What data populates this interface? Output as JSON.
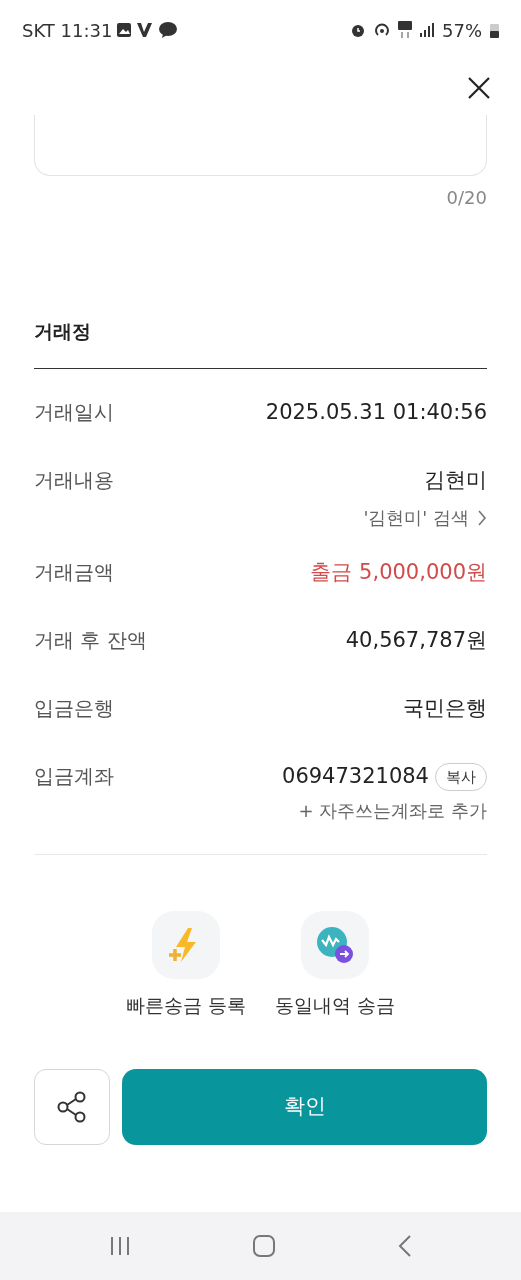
{
  "status_bar": {
    "carrier_time": "SKT 11:31",
    "battery": "57%"
  },
  "memo": {
    "counter": "0/20"
  },
  "section": {
    "title": "거래정"
  },
  "details": [
    {
      "label": "거래일시",
      "value": "2025.05.31 01:40:56",
      "kind": "plain"
    },
    {
      "label": "거래내용",
      "value": "김현미",
      "kind": "search",
      "link": "'김현미' 검색"
    },
    {
      "label": "거래금액",
      "value": "출금 5,000,000원",
      "kind": "withdrawal"
    },
    {
      "label": "거래 후 잔액",
      "value": "40,567,787원",
      "kind": "plain"
    },
    {
      "label": "입금은행",
      "value": "국민은행",
      "kind": "plain"
    },
    {
      "label": "입금계좌",
      "value": "06947321084",
      "kind": "account",
      "copy": "복사",
      "add": "+ 자주쓰는계좌로 추가"
    }
  ],
  "actions": [
    {
      "label": "빠른송금 등록",
      "kind": "bolt"
    },
    {
      "label": "동일내역 송금",
      "kind": "resend"
    }
  ],
  "confirm_button": "확인"
}
